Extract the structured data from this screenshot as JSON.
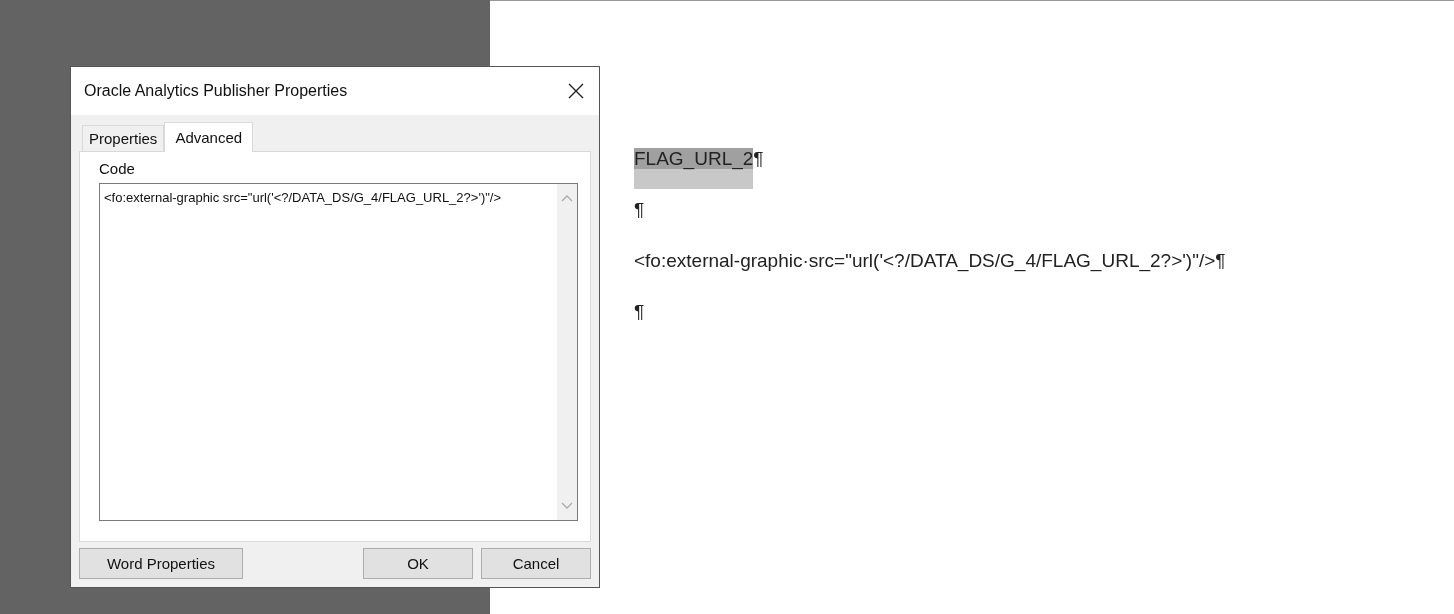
{
  "dialog": {
    "title": "Oracle Analytics Publisher Properties",
    "tabs": [
      {
        "label": "Properties",
        "selected": false
      },
      {
        "label": "Advanced",
        "selected": true
      }
    ],
    "code_label": "Code",
    "code_value": "<fo:external-graphic src=\"url('<?/DATA_DS/G_4/FLAG_URL_2?>')\"/>",
    "buttons": [
      {
        "label": "Word Properties",
        "kind": "left"
      },
      {
        "label": "OK",
        "kind": "right"
      },
      {
        "label": "Cancel",
        "kind": "right"
      }
    ]
  },
  "document": {
    "paragraphs": [
      {
        "kind": "field",
        "text": "FLAG_URL_2",
        "mark": "¶"
      },
      {
        "kind": "empty",
        "mark": "¶"
      },
      {
        "kind": "text",
        "text": "<fo:external-graphic·src=\"url('<?/DATA_DS/G_4/FLAG_URL_2?>')\"/>",
        "mark": "¶"
      },
      {
        "kind": "empty",
        "mark": "¶"
      }
    ]
  }
}
